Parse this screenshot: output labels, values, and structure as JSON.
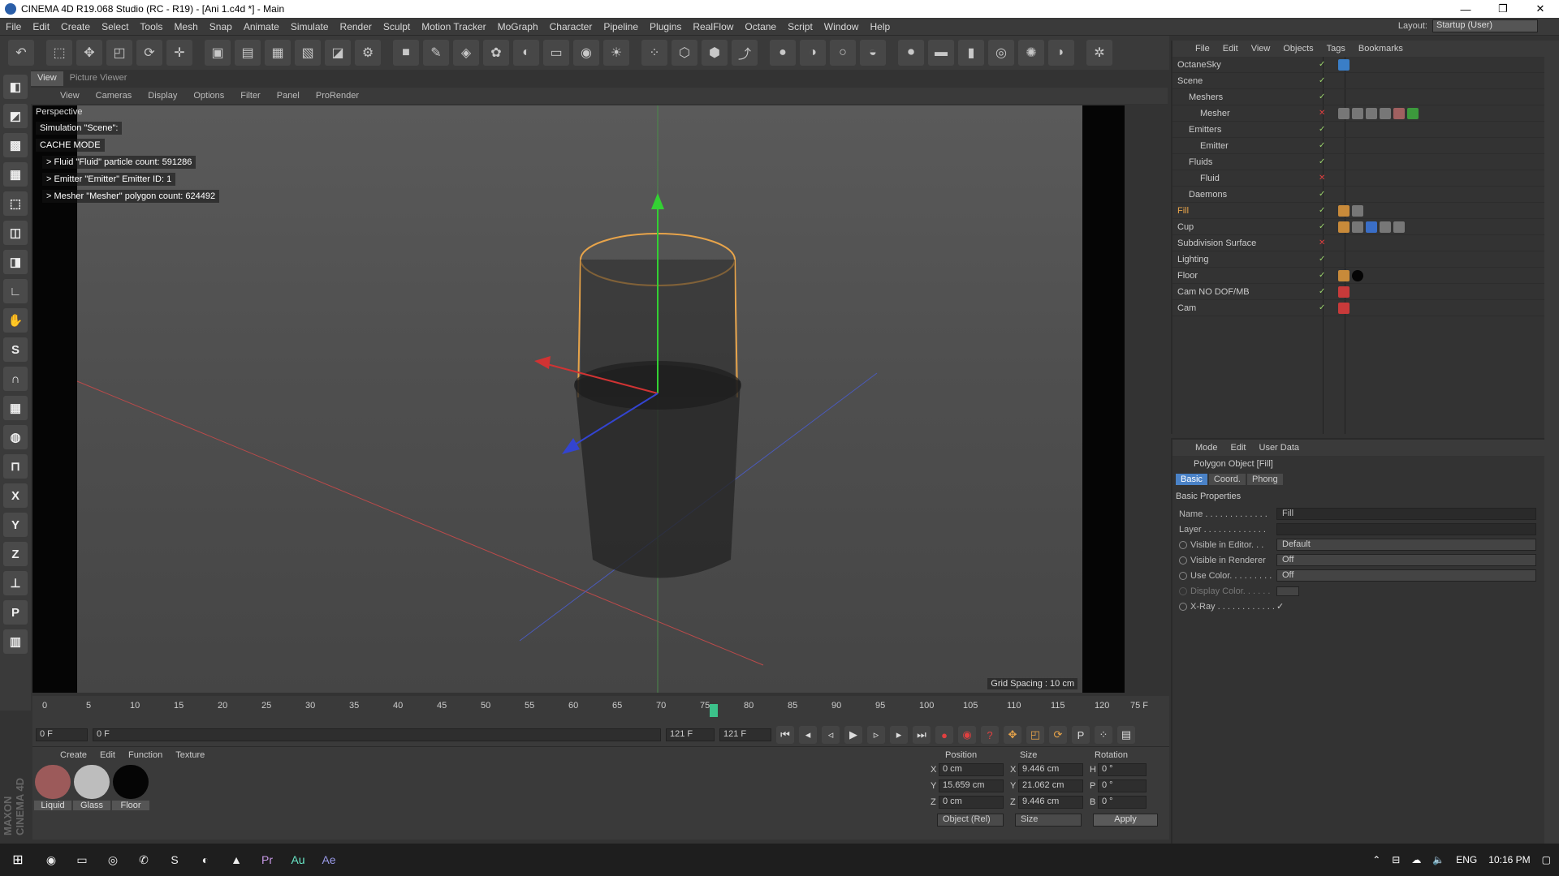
{
  "window": {
    "title": "CINEMA 4D R19.068 Studio (RC - R19) - [Ani 1.c4d *] - Main",
    "controls": [
      "—",
      "❐",
      "✕"
    ]
  },
  "menubar": {
    "items": [
      "File",
      "Edit",
      "Create",
      "Select",
      "Tools",
      "Mesh",
      "Snap",
      "Animate",
      "Simulate",
      "Render",
      "Sculpt",
      "Motion Tracker",
      "MoGraph",
      "Character",
      "Pipeline",
      "Plugins",
      "RealFlow",
      "Octane",
      "Script",
      "Window",
      "Help"
    ],
    "layout_label": "Layout:",
    "layout_value": "Startup (User)"
  },
  "viewport": {
    "tabs": [
      "View",
      "Picture Viewer"
    ],
    "menu": [
      "View",
      "Cameras",
      "Display",
      "Options",
      "Filter",
      "Panel",
      "ProRender"
    ],
    "camera_label": "Perspective",
    "hud": {
      "simulation": "Simulation \"Scene\":",
      "cache_mode": "CACHE MODE",
      "fluid": "> Fluid \"Fluid\" particle count: 591286",
      "emitter": "> Emitter \"Emitter\" Emitter ID: 1",
      "mesher": "> Mesher \"Mesher\" polygon count: 624492"
    },
    "grid_spacing": "Grid Spacing : 10 cm"
  },
  "timeline": {
    "ticks": [
      "0",
      "5",
      "10",
      "15",
      "20",
      "25",
      "30",
      "35",
      "40",
      "45",
      "50",
      "55",
      "60",
      "65",
      "70",
      "75",
      "80",
      "85",
      "90",
      "95",
      "100",
      "105",
      "110",
      "115",
      "120"
    ],
    "current_frame": "75 F",
    "start": "0 F",
    "range_start": "0 F",
    "range_end": "121 F",
    "end": "121 F"
  },
  "materials": {
    "menu": [
      "Create",
      "Edit",
      "Function",
      "Texture"
    ],
    "items": [
      {
        "name": "Liquid",
        "color": "#9c5a5a"
      },
      {
        "name": "Glass",
        "color": "#bdbdbd"
      },
      {
        "name": "Floor",
        "color": "#050505"
      }
    ]
  },
  "coordinates": {
    "headers": [
      "Position",
      "Size",
      "Rotation"
    ],
    "rows": [
      {
        "ax": "X",
        "pos": "0 cm",
        "sax": "X",
        "size": "9.446 cm",
        "rax": "H",
        "rot": "0 °"
      },
      {
        "ax": "Y",
        "pos": "15.659 cm",
        "sax": "Y",
        "size": "21.062 cm",
        "rax": "P",
        "rot": "0 °"
      },
      {
        "ax": "Z",
        "pos": "0 cm",
        "sax": "Z",
        "size": "9.446 cm",
        "rax": "B",
        "rot": "0 °"
      }
    ],
    "mode": "Object (Rel)",
    "size_mode": "Size",
    "apply": "Apply"
  },
  "object_manager": {
    "menu": [
      "File",
      "Edit",
      "View",
      "Objects",
      "Tags",
      "Bookmarks"
    ],
    "objects": [
      {
        "name": "OctaneSky",
        "indent": 0,
        "orange": false
      },
      {
        "name": "Scene",
        "indent": 0,
        "orange": false
      },
      {
        "name": "Meshers",
        "indent": 1,
        "orange": false
      },
      {
        "name": "Mesher",
        "indent": 2,
        "orange": false
      },
      {
        "name": "Emitters",
        "indent": 1,
        "orange": false
      },
      {
        "name": "Emitter",
        "indent": 2,
        "orange": false
      },
      {
        "name": "Fluids",
        "indent": 1,
        "orange": false
      },
      {
        "name": "Fluid",
        "indent": 2,
        "orange": false
      },
      {
        "name": "Daemons",
        "indent": 1,
        "orange": false
      },
      {
        "name": "Fill",
        "indent": 0,
        "orange": true
      },
      {
        "name": "Cup",
        "indent": 0,
        "orange": false
      },
      {
        "name": "Subdivision Surface",
        "indent": 0,
        "orange": false
      },
      {
        "name": "Lighting",
        "indent": 0,
        "orange": false
      },
      {
        "name": "Floor",
        "indent": 0,
        "orange": false
      },
      {
        "name": "Cam NO DOF/MB",
        "indent": 0,
        "orange": false
      },
      {
        "name": "Cam",
        "indent": 0,
        "orange": false
      }
    ]
  },
  "attribute_manager": {
    "menu": [
      "Mode",
      "Edit",
      "User Data"
    ],
    "object_title": "Polygon Object [Fill]",
    "tabs": [
      "Basic",
      "Coord.",
      "Phong"
    ],
    "section": "Basic Properties",
    "name_label": "Name . . . . . . . . . . . . .",
    "name_value": "Fill",
    "layer_label": "Layer . . . . . . . . . . . . .",
    "visible_editor_label": "Visible in Editor. . .",
    "visible_editor_value": "Default",
    "visible_renderer_label": "Visible in Renderer",
    "visible_renderer_value": "Off",
    "use_color_label": "Use Color. . . . . . . . .",
    "use_color_value": "Off",
    "display_color_label": "Display Color. . . . . .",
    "xray_label": "X-Ray . . . . . . . . . . . .",
    "xray_value": "✓"
  },
  "taskbar": {
    "lang": "ENG",
    "time": "10:16 PM"
  },
  "brand": "MAXON CINEMA 4D"
}
